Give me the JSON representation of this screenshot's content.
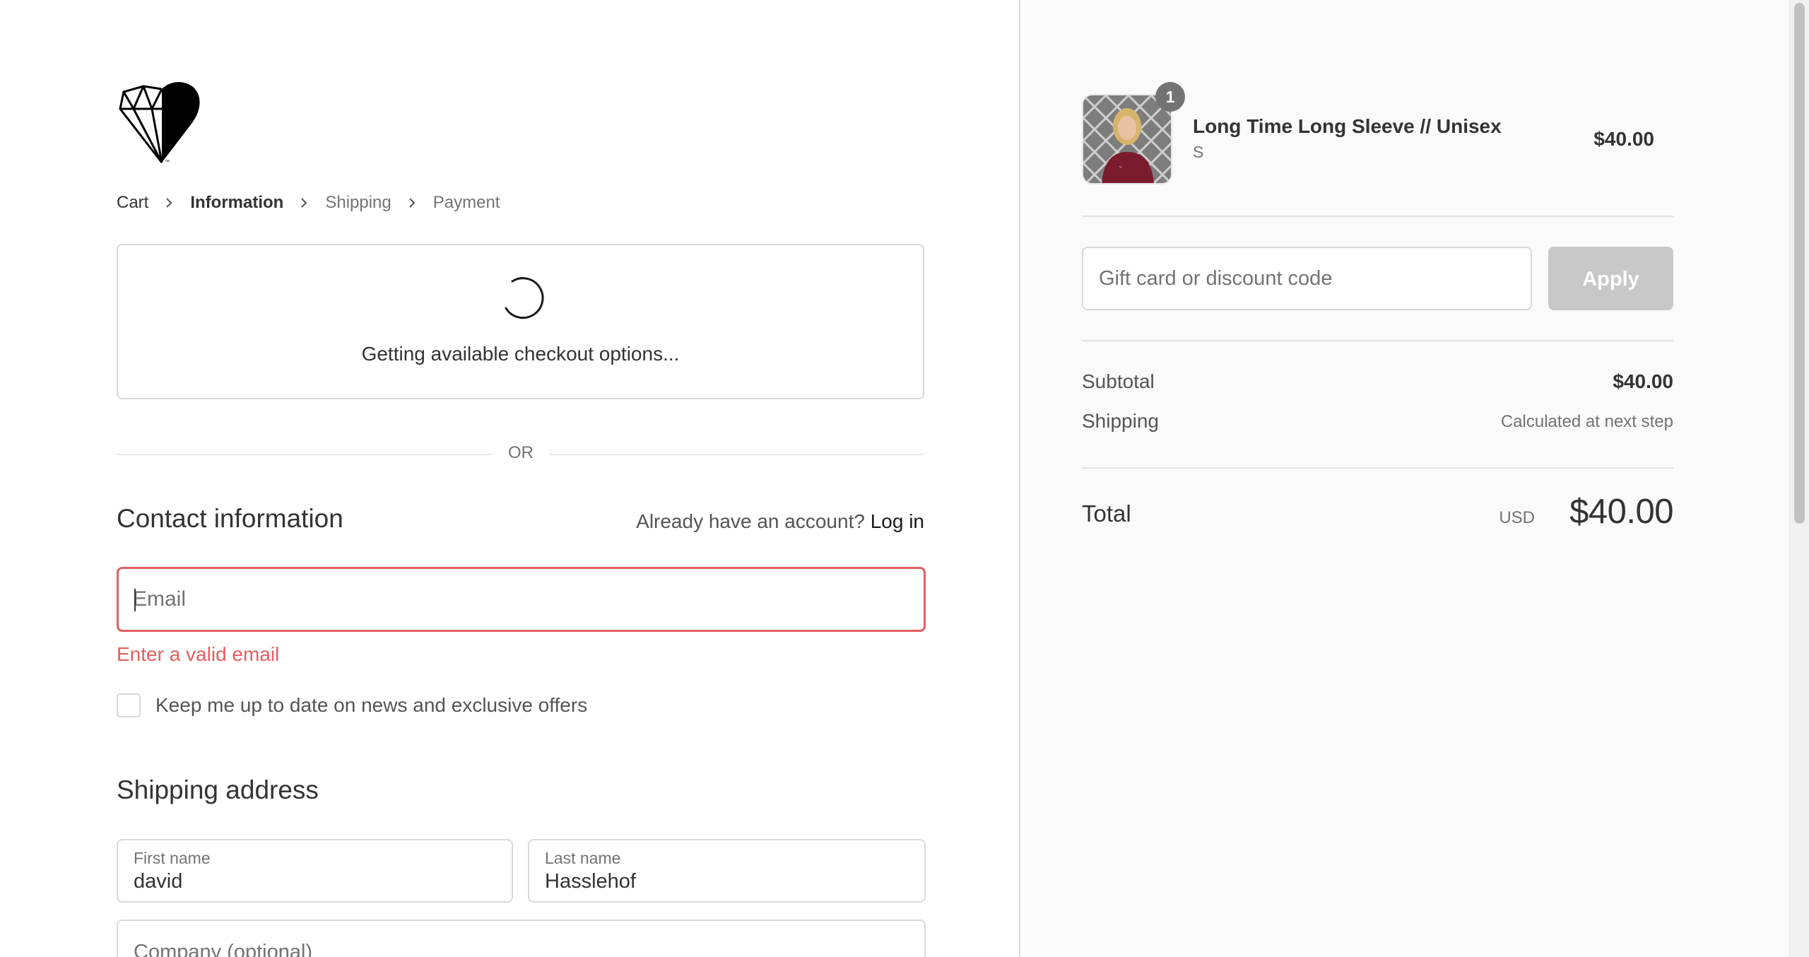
{
  "store": {
    "logo_icon": "diamond-heart-logo"
  },
  "breadcrumb": [
    {
      "label": "Cart",
      "state": "link"
    },
    {
      "label": "Information",
      "state": "current"
    },
    {
      "label": "Shipping",
      "state": "upcoming"
    },
    {
      "label": "Payment",
      "state": "upcoming"
    }
  ],
  "express_checkout": {
    "loading_text": "Getting available checkout options..."
  },
  "divider": {
    "or_text": "OR"
  },
  "contact": {
    "title": "Contact information",
    "account_prompt": "Already have an account?",
    "login_link": "Log in",
    "email_placeholder": "Email",
    "email_value": "",
    "email_error": "Enter a valid email",
    "newsletter_label": "Keep me up to date on news and exclusive offers",
    "newsletter_checked": false
  },
  "shipping_address": {
    "title": "Shipping address",
    "first_name_label": "First name",
    "first_name_value": "david",
    "last_name_label": "Last name",
    "last_name_value": "Hasslehof",
    "company_placeholder": "Company (optional)"
  },
  "order_summary": {
    "item": {
      "name": "Long Time Long Sleeve // Unisex",
      "variant": "S",
      "price": "$40.00",
      "quantity": "1"
    },
    "discount_placeholder": "Gift card or discount code",
    "apply_label": "Apply",
    "subtotal_label": "Subtotal",
    "subtotal_value": "$40.00",
    "shipping_label": "Shipping",
    "shipping_value": "Calculated at next step",
    "total_label": "Total",
    "total_currency": "USD",
    "total_value": "$40.00"
  },
  "colors": {
    "error": "#e35f5f",
    "sidebar_bg": "#fafafa",
    "apply_disabled": "#c8c8c8"
  }
}
